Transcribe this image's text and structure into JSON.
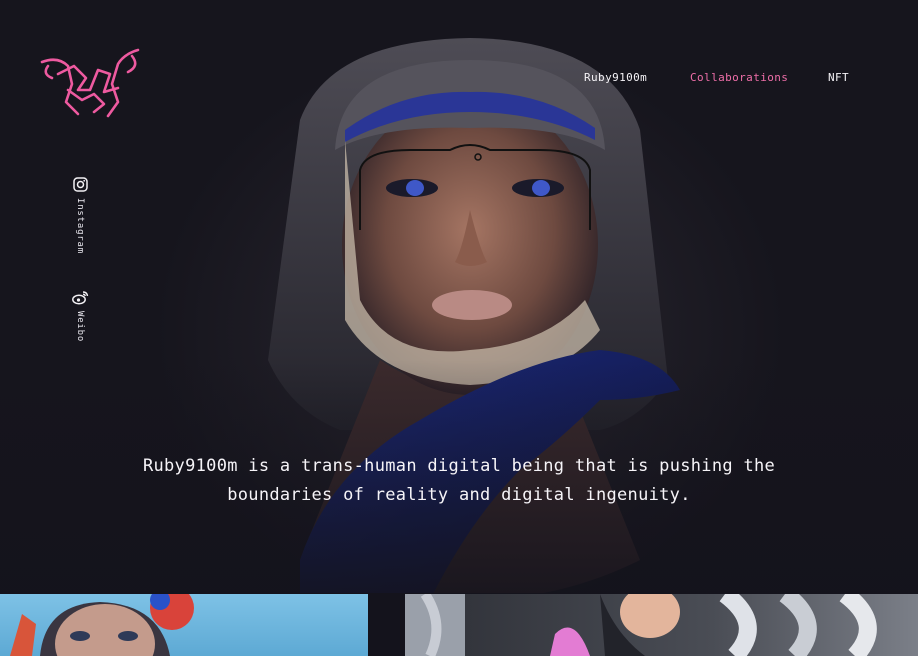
{
  "brand": {
    "logo_text": "Ruby9100m"
  },
  "nav": {
    "items": [
      {
        "label": "Ruby9100m",
        "active": false
      },
      {
        "label": "Collaborations",
        "active": true
      },
      {
        "label": "NFT",
        "active": false
      }
    ],
    "active_color": "#ee6ea8"
  },
  "social": [
    {
      "label": "Instagram",
      "icon": "instagram-icon"
    },
    {
      "label": "Weibo",
      "icon": "weibo-icon"
    }
  ],
  "hero": {
    "tagline_line1": "Ruby9100m is a trans-human digital being that is pushing the",
    "tagline_line2": "boundaries of reality and digital ingenuity."
  },
  "colors": {
    "background": "#14131c",
    "accent": "#ee6ea8"
  }
}
